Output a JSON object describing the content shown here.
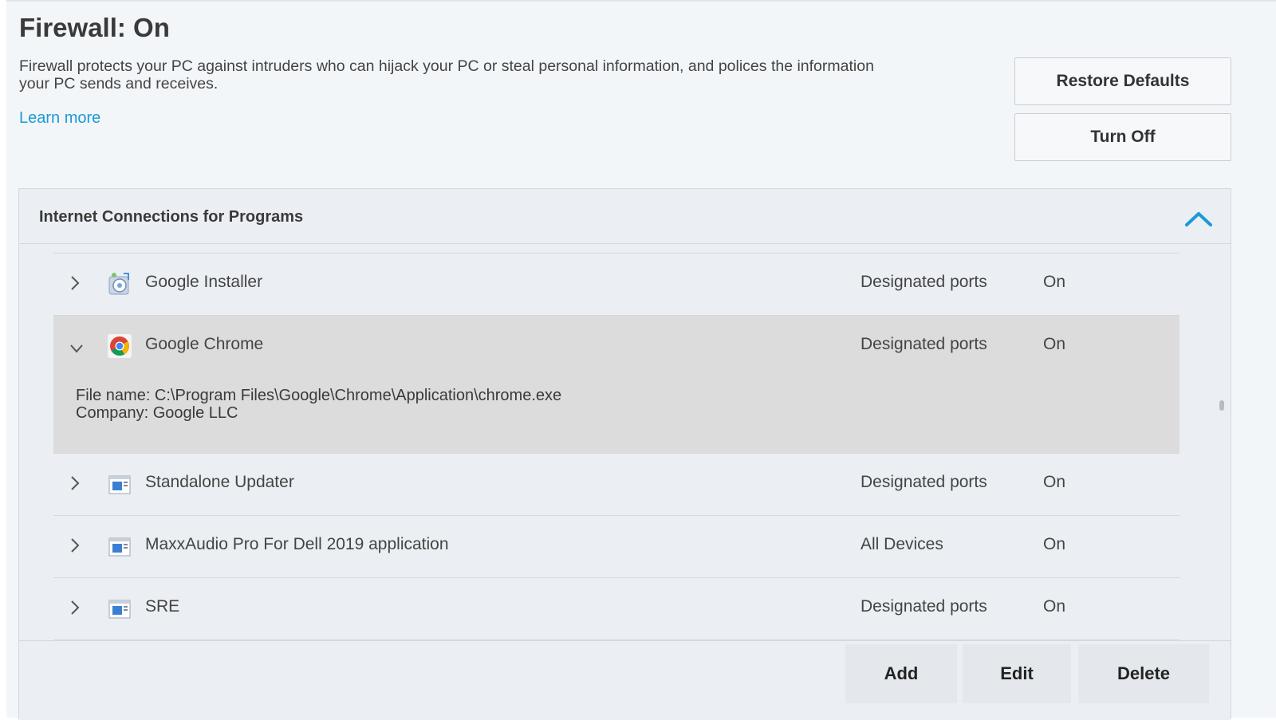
{
  "header": {
    "title": "Firewall: On",
    "description": "Firewall protects your PC against intruders who can hijack your PC or steal personal information, and polices the information your PC sends and receives.",
    "learn_more": "Learn more"
  },
  "actions": {
    "restore_defaults": "Restore Defaults",
    "turn_off": "Turn Off"
  },
  "panel": {
    "title": "Internet Connections for Programs",
    "programs": [
      {
        "name": "Google Installer",
        "ports": "Designated ports",
        "status": "On",
        "icon": "installer-icon",
        "expanded": false
      },
      {
        "name": "Google Chrome",
        "ports": "Designated ports",
        "status": "On",
        "icon": "chrome-icon",
        "expanded": true,
        "file_name": "File name: C:\\Program Files\\Google\\Chrome\\Application\\chrome.exe",
        "company": "Company: Google LLC"
      },
      {
        "name": "Standalone Updater",
        "ports": "Designated ports",
        "status": "On",
        "icon": "app-window-icon",
        "expanded": false
      },
      {
        "name": "MaxxAudio Pro For Dell 2019 application",
        "ports": "All Devices",
        "status": "On",
        "icon": "app-window-icon",
        "expanded": false
      },
      {
        "name": "SRE",
        "ports": "Designated ports",
        "status": "On",
        "icon": "app-window-icon",
        "expanded": false
      }
    ]
  },
  "footer": {
    "add": "Add",
    "edit": "Edit",
    "delete": "Delete"
  },
  "colors": {
    "accent": "#1c9ad6",
    "background": "#f3f6f9",
    "panel": "#ebeff3",
    "selected_row": "#dcdcdc"
  }
}
